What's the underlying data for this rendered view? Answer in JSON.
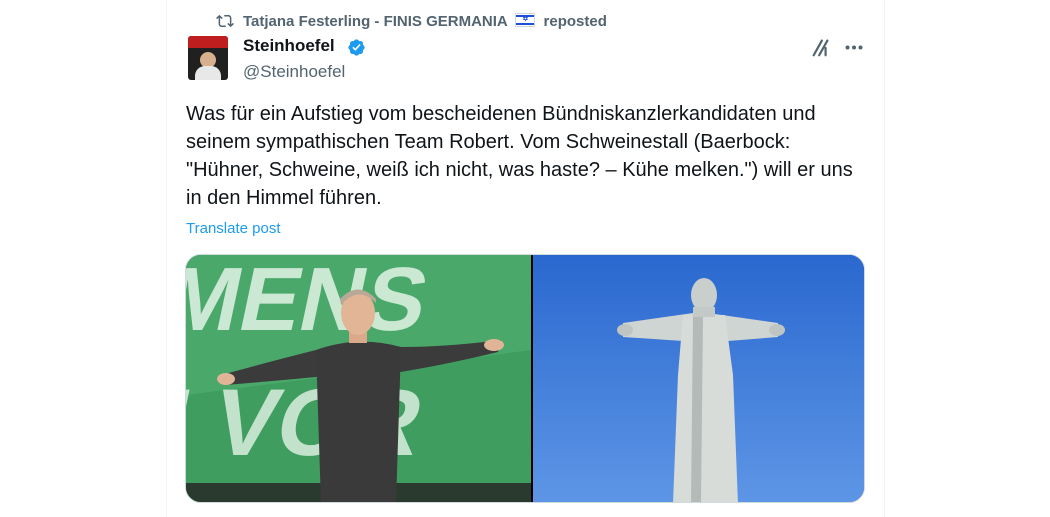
{
  "repost": {
    "icon": "repost-icon",
    "user": "Tatjana Festerling - FINIS GERMANIA",
    "flag": "israel-flag-emoji",
    "suffix": "reposted"
  },
  "author": {
    "name": "Steinhoefel",
    "handle": "@Steinhoefel",
    "verified": true,
    "badge_color": "#1d9bf0"
  },
  "actions": {
    "grok_icon": "grok-icon",
    "more_icon": "more-horizontal-icon"
  },
  "post": {
    "text": "Was für ein Aufstieg vom bescheidenen Bündniskanzlerkandidaten und seinem sympathischen Team Robert. Vom Schweinestall (Baerbock: \"Hühner, Schweine, weiß ich nicht, was haste? – Kühe melken.\") will er uns in den Himmel führen.",
    "translate_label": "Translate post"
  },
  "media": {
    "count": 2,
    "images": [
      "photo-man-arms-outstretched",
      "photo-christ-the-redeemer-statue"
    ]
  },
  "colors": {
    "link": "#1d9bf0",
    "secondary_text": "#536471",
    "primary_text": "#0f1419"
  }
}
